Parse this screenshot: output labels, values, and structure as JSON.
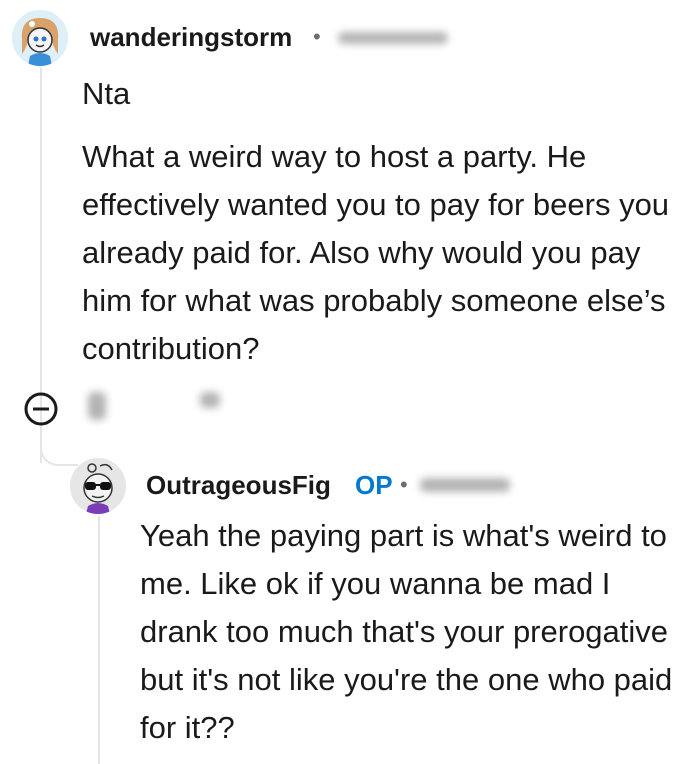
{
  "comments": [
    {
      "username": "wanderingstorm",
      "separator": "•",
      "short_text": "Nta",
      "text": "What a weird way to host a party. He effectively wanted you to pay for beers you already paid for. Also why would you pay him for what was probably someone else’s contribution?",
      "icons": [
        "avatar",
        "minus-circle-icon"
      ]
    },
    {
      "username": "OutrageousFig",
      "badge": "OP",
      "separator": "•",
      "text": "Yeah the paying part is what's weird to me. Like ok if you wanna be mad I drank too much that's your prerogative but it's not like you're the one who paid for it??",
      "icons": [
        "avatar"
      ]
    }
  ],
  "colors": {
    "op_badge": "#0079d3",
    "thread_line": "#e5e5e5",
    "text": "#1a1a1b"
  }
}
